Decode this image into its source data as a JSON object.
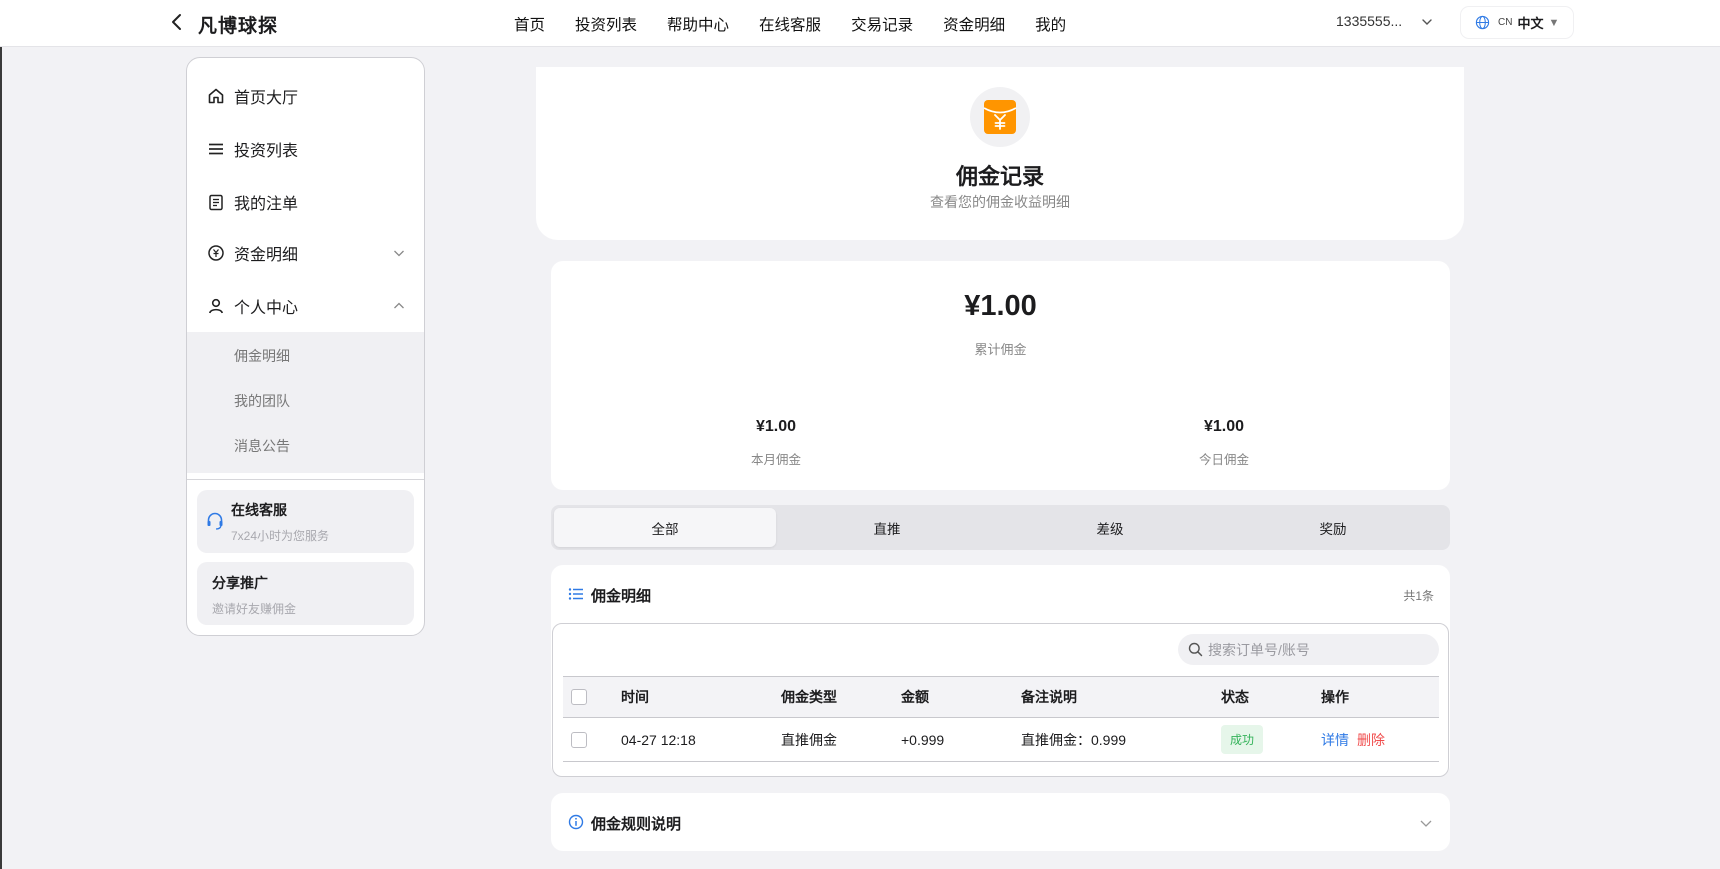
{
  "header": {
    "brand": "凡博球探",
    "nav": [
      "首页",
      "投资列表",
      "帮助中心",
      "在线客服",
      "交易记录",
      "资金明细",
      "我的"
    ],
    "account": "1335555...",
    "lang_code": "CN",
    "lang_name": "中文"
  },
  "sidebar": {
    "items": [
      {
        "label": "首页大厅",
        "icon": "home-icon"
      },
      {
        "label": "投资列表",
        "icon": "list-icon"
      },
      {
        "label": "我的注单",
        "icon": "document-icon"
      },
      {
        "label": "资金明细",
        "icon": "yuan-circle-icon"
      },
      {
        "label": "个人中心",
        "icon": "user-icon"
      }
    ],
    "subitems": [
      "佣金明细",
      "我的团队",
      "消息公告"
    ],
    "service": {
      "title": "在线客服",
      "subtitle": "7x24小时为您服务"
    },
    "share": {
      "title": "分享推广",
      "subtitle": "邀请好友赚佣金"
    }
  },
  "hero": {
    "title": "佣金记录",
    "subtitle": "查看您的佣金收益明细"
  },
  "summary": {
    "total": "¥1.00",
    "total_label": "累计佣金",
    "month": "¥1.00",
    "month_label": "本月佣金",
    "today": "¥1.00",
    "today_label": "今日佣金"
  },
  "tabs": [
    "全部",
    "直推",
    "差级",
    "奖励"
  ],
  "detail": {
    "title": "佣金明细",
    "count": "共1条",
    "search_placeholder": "搜索订单号/账号",
    "columns": [
      "时间",
      "佣金类型",
      "金额",
      "备注说明",
      "状态",
      "操作"
    ],
    "rows": [
      {
        "time": "04-27 12:18",
        "type": "直推佣金",
        "amount": "+0.999",
        "note": "直推佣金：0.999",
        "status": "成功",
        "action_detail": "详情",
        "action_delete": "删除"
      }
    ]
  },
  "rules": {
    "title": "佣金规则说明"
  },
  "colors": {
    "accent_orange": "#ff9500",
    "link_blue": "#2f7ae5",
    "danger_red": "#f04c4c",
    "success_green": "#34b35a"
  }
}
